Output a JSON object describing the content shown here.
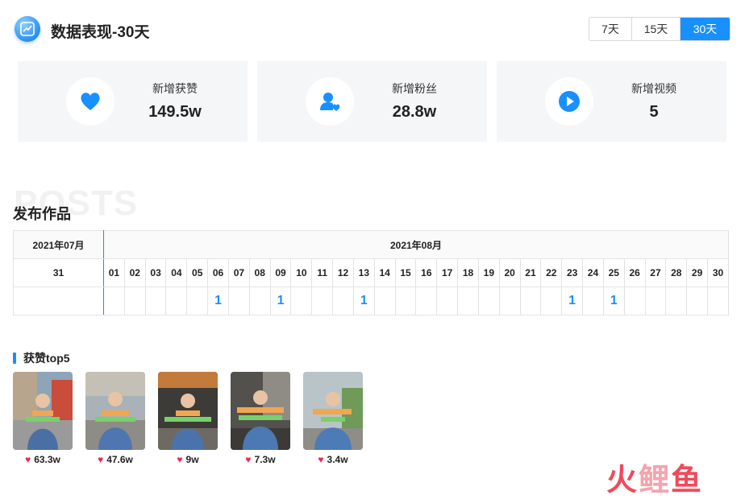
{
  "header": {
    "title": "数据表现-30天"
  },
  "range_tabs": [
    {
      "label": "7天",
      "active": false
    },
    {
      "label": "15天",
      "active": false
    },
    {
      "label": "30天",
      "active": true
    }
  ],
  "stats": [
    {
      "label": "新增获赞",
      "value": "149.5w",
      "icon": "heart-icon"
    },
    {
      "label": "新增粉丝",
      "value": "28.8w",
      "icon": "user-add-icon"
    },
    {
      "label": "新增视频",
      "value": "5",
      "icon": "play-icon"
    }
  ],
  "posts": {
    "ghost_text": "POSTS",
    "title": "发布作品",
    "months": [
      "2021年07月",
      "2021年08月"
    ],
    "july_days": [
      "31"
    ],
    "august_days": [
      "01",
      "02",
      "03",
      "04",
      "05",
      "06",
      "07",
      "08",
      "09",
      "10",
      "11",
      "12",
      "13",
      "14",
      "15",
      "16",
      "17",
      "18",
      "19",
      "20",
      "21",
      "22",
      "23",
      "24",
      "25",
      "26",
      "27",
      "28",
      "29",
      "30"
    ],
    "july_counts": [
      ""
    ],
    "august_counts": [
      "",
      "",
      "",
      "",
      "",
      "1",
      "",
      "",
      "1",
      "",
      "",
      "",
      "1",
      "",
      "",
      "",
      "",
      "",
      "",
      "",
      "",
      "",
      "1",
      "",
      "1",
      "",
      "",
      "",
      "",
      ""
    ]
  },
  "top5": {
    "title": "获赞top5",
    "items": [
      {
        "likes": "63.3w"
      },
      {
        "likes": "47.6w"
      },
      {
        "likes": "9w"
      },
      {
        "likes": "7.3w"
      },
      {
        "likes": "3.4w"
      }
    ]
  },
  "watermark": "火鲤鱼",
  "colors": {
    "accent": "#1890ff",
    "like": "#f0264d"
  }
}
